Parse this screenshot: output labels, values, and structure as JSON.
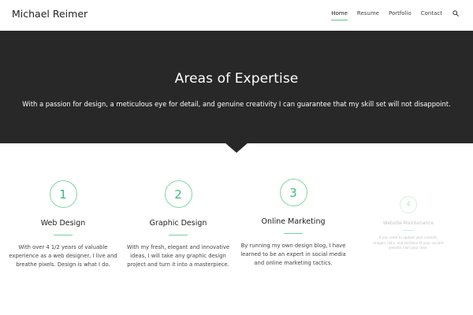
{
  "header": {
    "brand": "Michael Reimer",
    "nav": [
      {
        "label": "Home",
        "active": true
      },
      {
        "label": "Resume",
        "active": false
      },
      {
        "label": "Portfolio",
        "active": false
      },
      {
        "label": "Contact",
        "active": false
      }
    ],
    "search_icon": "search-icon"
  },
  "hero": {
    "title": "Areas of Expertise",
    "subtitle": "With a passion for design, a meticulous eye for detail, and genuine creativity I can guarantee that my skill set will not disappoint."
  },
  "expertise": [
    {
      "number": "1",
      "title": "Web Design",
      "text": "With over 4 1/2 years of valuable experience as a web designer, I live and breathe pixels. Design is what I do."
    },
    {
      "number": "2",
      "title": "Graphic Design",
      "text": "With my fresh, elegant and innovative ideas, I will take any graphic design project and turn it into a masterpiece."
    },
    {
      "number": "3",
      "title": "Online Marketing",
      "text": "By running my own design blog, I have learned to be an expert in social media and online marketing tactics."
    },
    {
      "number": "4",
      "title": "Website Maintenance",
      "text": "If you need to update your content, images, links, and sections of your current website I am your man."
    }
  ],
  "colors": {
    "accent": "#5cc489",
    "hero_bg": "#282828"
  }
}
